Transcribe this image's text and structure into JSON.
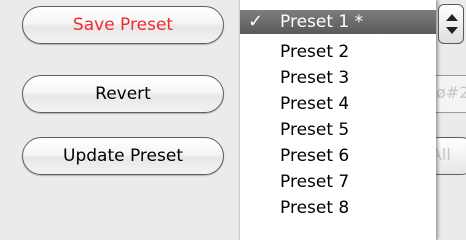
{
  "buttons": {
    "save_preset": "Save Preset",
    "revert": "Revert",
    "update_preset": "Update Preset"
  },
  "behind_menu": {
    "field_fragment": "ø#2",
    "button_fragment": "e All"
  },
  "preset_menu": {
    "selected_index": 0,
    "items": [
      "Preset 1 *",
      "Preset 2",
      "Preset 3",
      "Preset 4",
      "Preset 5",
      "Preset 6",
      "Preset 7",
      "Preset 8"
    ],
    "check_icon": "checkmark-icon"
  },
  "colors": {
    "save_label": "#ee2a2a",
    "selected_row": "#6a6a6a"
  }
}
